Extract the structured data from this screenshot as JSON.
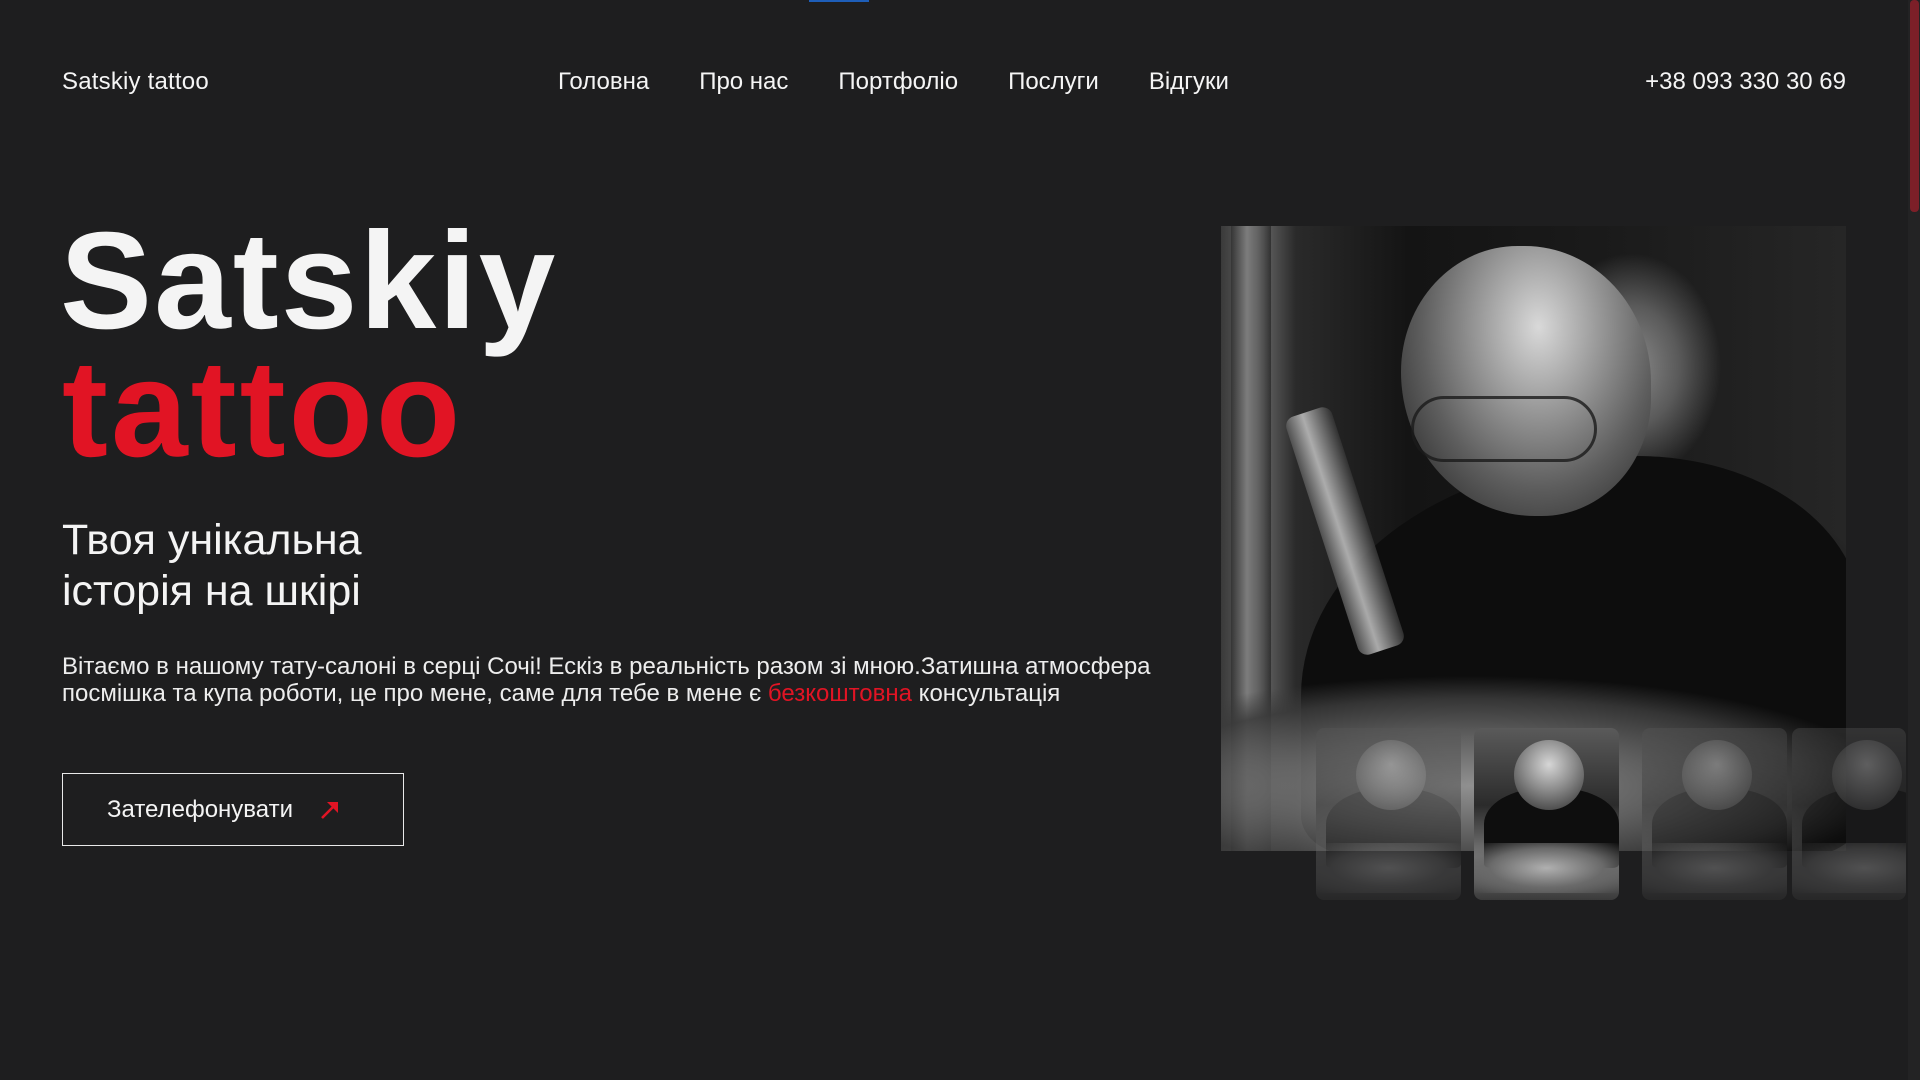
{
  "header": {
    "logo": "Satskiy tattoo",
    "nav": [
      "Головна",
      "Про нас",
      "Портфоліо",
      "Послуги",
      "Відгуки"
    ],
    "phone": "+38 093 330 30 69"
  },
  "hero": {
    "title_line1": "Satskiy",
    "title_line2": "tattoo",
    "tagline_line1": "Твоя унікальна",
    "tagline_line2": "історія на шкірі",
    "intro_text": "Вітаємо в нашому тату-салоні в серці Сочі! Ескіз в реальність разом зі мною.Затишна атмосфера посмішка та купа роботи, це про мене, саме для тебе в мене є ",
    "intro_accent": "безкоштовна",
    "intro_tail": " консультація",
    "call_button": "Зателефонувати"
  },
  "gallery": {
    "thumbnails": [
      "thumb-1",
      "thumb-2",
      "thumb-3",
      "thumb-4"
    ],
    "active_index": 1
  },
  "colors": {
    "background": "#1e1e1f",
    "text": "#f4f4f4",
    "accent": "#e11424"
  },
  "icons": {
    "call_button_icon": "arrow-up-right-icon"
  }
}
